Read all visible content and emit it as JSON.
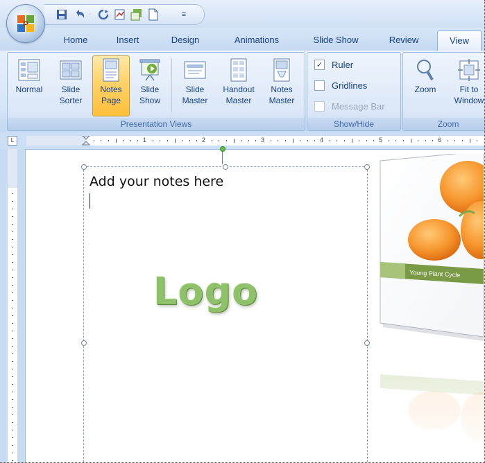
{
  "tabs": [
    "Home",
    "Insert",
    "Design",
    "Animations",
    "Slide Show",
    "Review",
    "View"
  ],
  "active_tab": "View",
  "groups": {
    "presentation_views": {
      "label": "Presentation Views",
      "buttons": [
        {
          "line1": "Normal",
          "line2": "",
          "icon": "normal-view-icon"
        },
        {
          "line1": "Slide",
          "line2": "Sorter",
          "icon": "slide-sorter-icon"
        },
        {
          "line1": "Notes",
          "line2": "Page",
          "icon": "notes-page-icon",
          "selected": true
        },
        {
          "line1": "Slide",
          "line2": "Show",
          "icon": "slide-show-icon"
        },
        {
          "line1": "Slide",
          "line2": "Master",
          "icon": "slide-master-icon"
        },
        {
          "line1": "Handout",
          "line2": "Master",
          "icon": "handout-master-icon"
        },
        {
          "line1": "Notes",
          "line2": "Master",
          "icon": "notes-master-icon"
        }
      ]
    },
    "show_hide": {
      "label": "Show/Hide",
      "items": [
        {
          "label": "Ruler",
          "checked": true,
          "enabled": true
        },
        {
          "label": "Gridlines",
          "checked": false,
          "enabled": true
        },
        {
          "label": "Message Bar",
          "checked": false,
          "enabled": false
        }
      ]
    },
    "zoom": {
      "label": "Zoom",
      "buttons": [
        {
          "line1": "Zoom",
          "line2": "",
          "icon": "zoom-icon"
        },
        {
          "line1": "Fit to",
          "line2": "Window",
          "icon": "fit-to-window-icon"
        }
      ]
    }
  },
  "ruler_numbers": [
    "1",
    "2",
    "3",
    "4",
    "5",
    "6"
  ],
  "notes_placeholder": "Add your notes here",
  "logo_text": "Logo",
  "slide_caption": "Young Plant Cycle",
  "colors": {
    "accent": "#15428b",
    "selected": "#ffd26a",
    "logo": "#8fc06a",
    "orange": "#f28a1f"
  }
}
